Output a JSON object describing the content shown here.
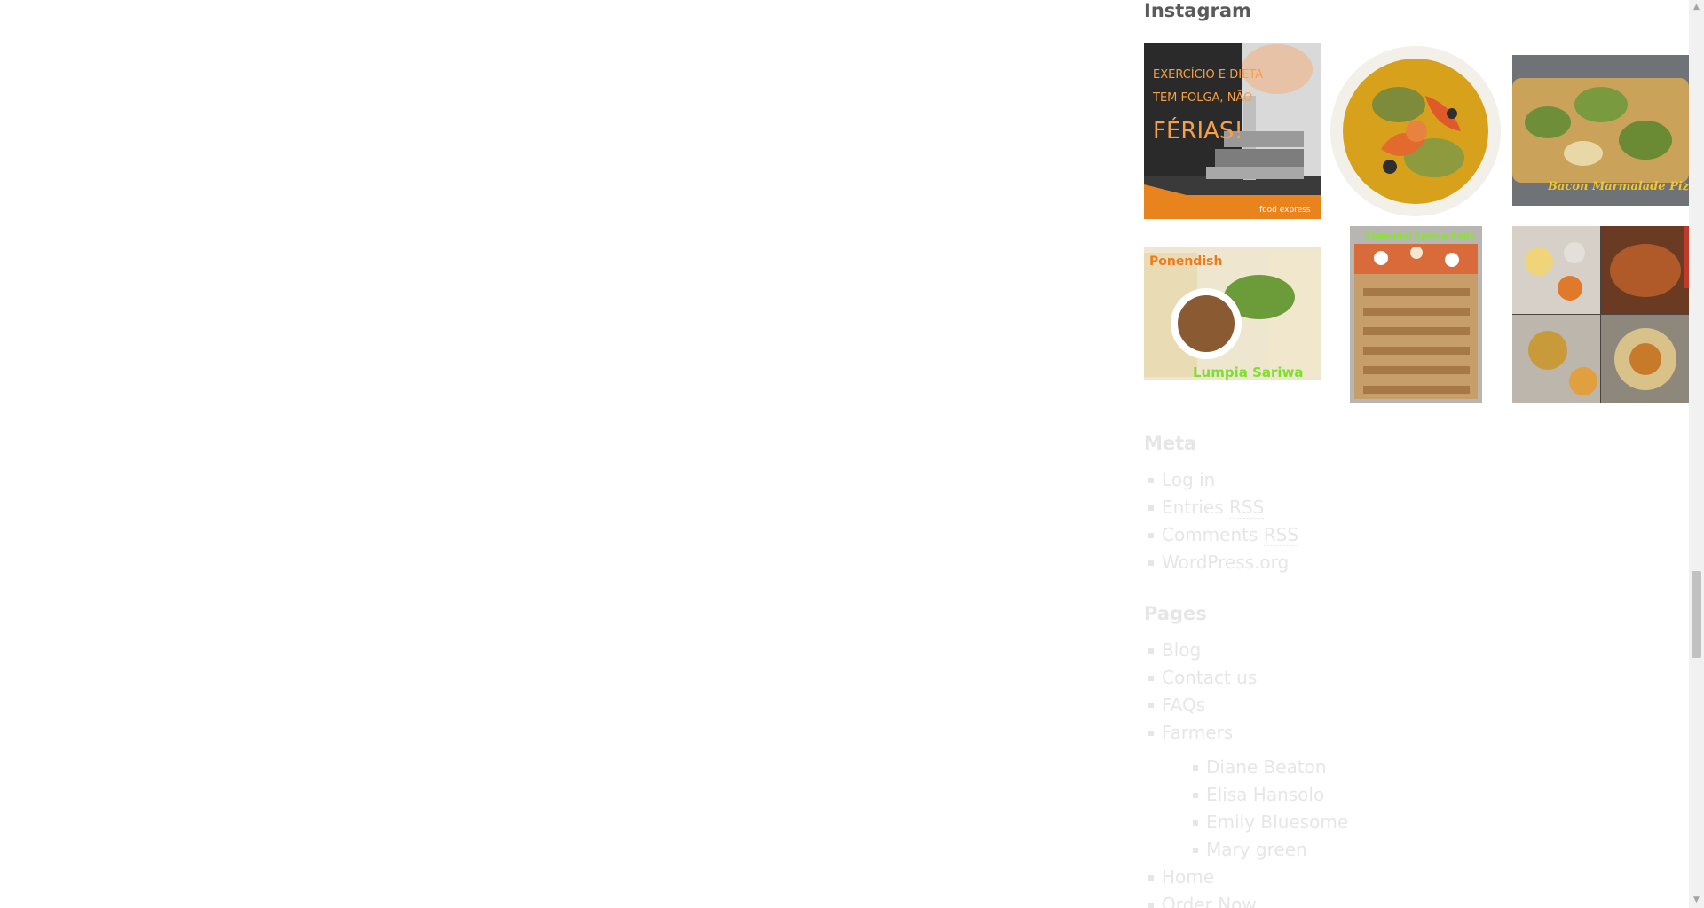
{
  "instagram": {
    "title": "Instagram",
    "posts": [
      {
        "icon": "photo-exercise",
        "overlay_lines": [
          "EXERCÍCIO E DIETA",
          "TEM FOLGA, NÃO",
          "FÉRIAS!"
        ],
        "brand": "food express"
      },
      {
        "icon": "photo-shrimp-curry"
      },
      {
        "icon": "photo-marmalade-pizza",
        "overlay_text": "Bacon Marmalade Pizza"
      },
      {
        "icon": "photo-lumpia",
        "overlay_top": "Ponendish",
        "overlay_text": "Lumpia Sariwa"
      },
      {
        "icon": "photo-spring-rolls",
        "overlay_text": "Shanghai Spring Rolls"
      },
      {
        "icon": "photo-thali"
      }
    ]
  },
  "meta": {
    "title": "Meta",
    "items": [
      {
        "label": "Log in"
      },
      {
        "label": "Entries",
        "rss": "RSS"
      },
      {
        "label": "Comments",
        "rss": "RSS"
      },
      {
        "label": "WordPress.org"
      }
    ]
  },
  "pages": {
    "title": "Pages",
    "items": [
      {
        "label": "Blog"
      },
      {
        "label": "Contact us"
      },
      {
        "label": "FAQs"
      },
      {
        "label": "Farmers",
        "children": [
          {
            "label": "Diane Beaton"
          },
          {
            "label": "Elisa Hansolo"
          },
          {
            "label": "Emily Bluesome"
          },
          {
            "label": "Mary green"
          }
        ]
      },
      {
        "label": "Home"
      },
      {
        "label": "Order Now"
      }
    ]
  },
  "colors": {
    "heading_dark": "#5a5a5a",
    "faded_text": "#e6e6e6",
    "brand_orange": "#e8831e"
  },
  "scrollbar": {
    "position_fraction": 0.63
  }
}
